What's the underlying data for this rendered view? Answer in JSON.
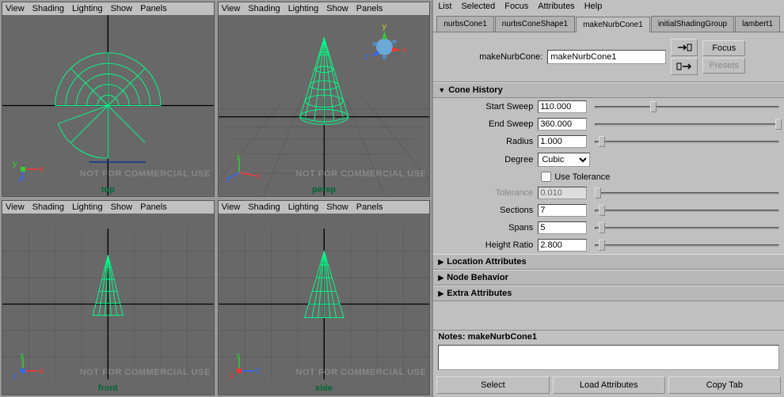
{
  "viewport_menu": [
    "View",
    "Shading",
    "Lighting",
    "Show",
    "Panels"
  ],
  "watermark": "NOT FOR COMMERCIAL USE",
  "viewports": {
    "top": "top",
    "persp": "persp",
    "front": "front",
    "side": "side"
  },
  "ae": {
    "menu": [
      "List",
      "Selected",
      "Focus",
      "Attributes",
      "Help"
    ],
    "tabs": [
      "nurbsCone1",
      "nurbsConeShape1",
      "makeNurbCone1",
      "initialShadingGroup",
      "lambert1"
    ],
    "active_tab": 2,
    "node_label": "makeNurbCone:",
    "node_name": "makeNurbCone1",
    "focus_btn": "Focus",
    "presets_btn": "Presets",
    "sections": {
      "cone_history": "Cone History",
      "location_attributes": "Location Attributes",
      "node_behavior": "Node Behavior",
      "extra_attributes": "Extra Attributes"
    },
    "attrs": {
      "start_sweep": {
        "label": "Start Sweep",
        "value": "110.000",
        "thumb": 30
      },
      "end_sweep": {
        "label": "End Sweep",
        "value": "360.000",
        "thumb": 98
      },
      "radius": {
        "label": "Radius",
        "value": "1.000",
        "thumb": 2
      },
      "degree": {
        "label": "Degree",
        "value": "Cubic"
      },
      "use_tolerance": {
        "label": "Use Tolerance",
        "checked": false
      },
      "tolerance": {
        "label": "Tolerance",
        "value": "0.010",
        "thumb": 0,
        "disabled": true
      },
      "sections": {
        "label": "Sections",
        "value": "7",
        "thumb": 2
      },
      "spans": {
        "label": "Spans",
        "value": "5",
        "thumb": 2
      },
      "height_ratio": {
        "label": "Height Ratio",
        "value": "2.800",
        "thumb": 2
      }
    },
    "notes_label": "Notes: makeNurbCone1",
    "footer": {
      "select": "Select",
      "load": "Load Attributes",
      "copy": "Copy Tab"
    }
  }
}
